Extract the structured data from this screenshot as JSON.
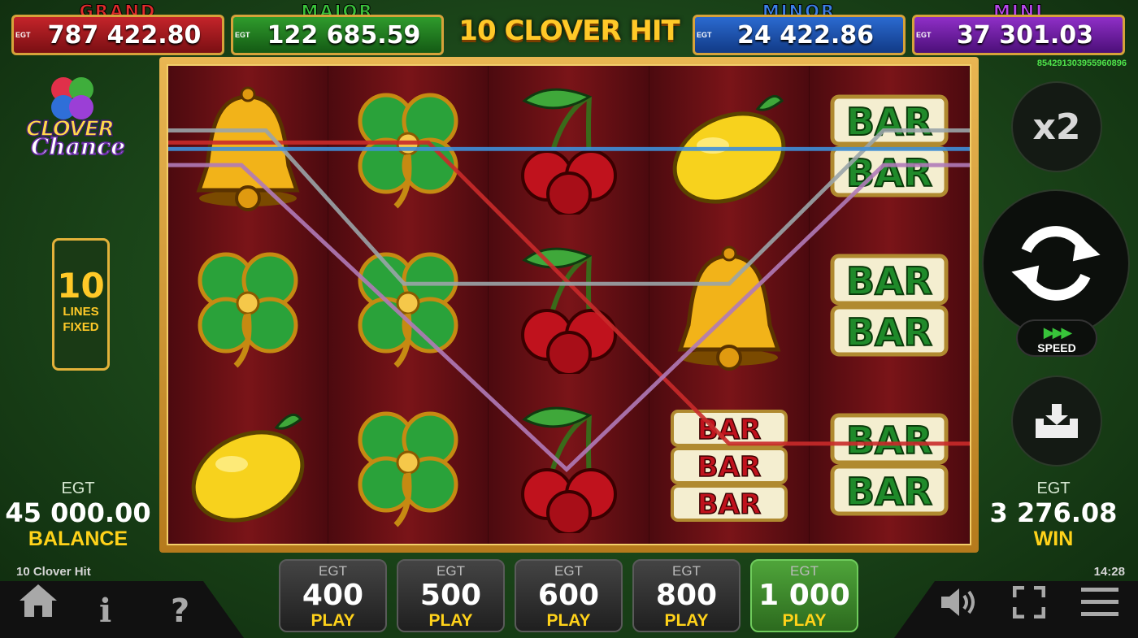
{
  "jackpots": [
    {
      "name": "GRAND",
      "egt": "EGT",
      "value": "787 422.80"
    },
    {
      "name": "MAJOR",
      "egt": "EGT",
      "value": "122 685.59"
    },
    {
      "name": "MINOR",
      "egt": "EGT",
      "value": "24 422.86"
    },
    {
      "name": "MINI",
      "egt": "EGT",
      "value": "37 301.03"
    }
  ],
  "game_title": "10 CLOVER HIT",
  "seed": "854291303955960896",
  "logo": {
    "line1": "CLOVER",
    "line2": "Chance"
  },
  "lines": {
    "count": "10",
    "label1": "LINES",
    "label2": "FIXED"
  },
  "balance": {
    "currency": "EGT",
    "value": "45 000.00",
    "label": "BALANCE"
  },
  "win": {
    "currency": "EGT",
    "value": "3 276.08",
    "label": "WIN"
  },
  "reels": [
    [
      "bell",
      "clover",
      "lemon"
    ],
    [
      "clover",
      "clover",
      "clover"
    ],
    [
      "cherry",
      "cherry",
      "cherry"
    ],
    [
      "lemon",
      "bell",
      "bar3"
    ],
    [
      "bar2",
      "bar2",
      "bar2"
    ]
  ],
  "controls": {
    "multiplier": "x2",
    "speed_label": "SPEED",
    "spin_icon": "refresh-icon",
    "autoplay_icon": "download-tray-icon"
  },
  "bets": [
    {
      "currency": "EGT",
      "value": "400",
      "label": "PLAY",
      "active": false
    },
    {
      "currency": "EGT",
      "value": "500",
      "label": "PLAY",
      "active": false
    },
    {
      "currency": "EGT",
      "value": "600",
      "label": "PLAY",
      "active": false
    },
    {
      "currency": "EGT",
      "value": "800",
      "label": "PLAY",
      "active": false
    },
    {
      "currency": "EGT",
      "value": "1 000",
      "label": "PLAY",
      "active": true
    }
  ],
  "footer": {
    "game_name": "10 Clover Hit",
    "time": "14:28",
    "info": "i",
    "help": "?"
  },
  "colors": {
    "grand": "#c4242a",
    "major": "#2f9b2c",
    "minor": "#2b6ad0",
    "mini": "#8f2fc7",
    "accent": "#ffd21a",
    "frame": "#e9b652"
  }
}
